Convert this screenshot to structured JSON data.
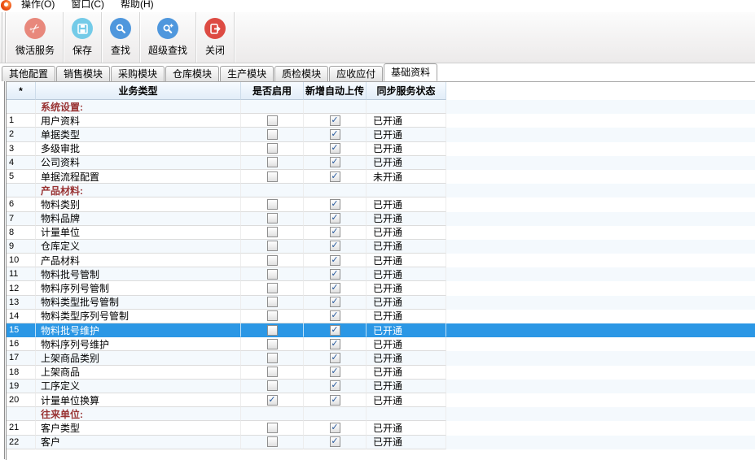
{
  "menu": {
    "logo_icon": "app-logo-icon",
    "items": [
      {
        "name": "operation",
        "label": "操作(O)"
      },
      {
        "name": "window",
        "label": "窗口(C)"
      },
      {
        "name": "help",
        "label": "帮助(H)"
      }
    ]
  },
  "toolbar": {
    "buttons": [
      {
        "name": "activate-service",
        "label": "微活服务",
        "icon": "scissors-icon",
        "circle_color": "#e8887c"
      },
      {
        "name": "save",
        "label": "保存",
        "icon": "floppy-disk-icon",
        "circle_color": "#74cbe8"
      },
      {
        "name": "find",
        "label": "查找",
        "icon": "magnifier-icon",
        "circle_color": "#4f97dd"
      },
      {
        "name": "super-find",
        "label": "超级查找",
        "icon": "magnifier-plus-icon",
        "circle_color": "#4f97dd"
      },
      {
        "name": "close",
        "label": "关闭",
        "icon": "exit-door-icon",
        "circle_color": "#dd4b43"
      }
    ]
  },
  "tabs": {
    "active": "基础资料",
    "items": [
      {
        "name": "other-config",
        "label": "其他配置"
      },
      {
        "name": "sales-module",
        "label": "销售模块"
      },
      {
        "name": "purchase-module",
        "label": "采购模块"
      },
      {
        "name": "warehouse-module",
        "label": "仓库模块"
      },
      {
        "name": "production-module",
        "label": "生产模块"
      },
      {
        "name": "qc-module",
        "label": "质检模块"
      },
      {
        "name": "ar-ap",
        "label": "应收应付"
      },
      {
        "name": "base-data",
        "label": "基础资料"
      }
    ]
  },
  "table": {
    "columns": [
      "*",
      "业务类型",
      "是否启用",
      "新增自动上传",
      "同步服务状态"
    ],
    "status_open": "已开通",
    "status_closed": "未开通",
    "selected_row": "15",
    "colors": {
      "selection_bg": "#2b97e5",
      "category_text": "#993333",
      "checkbox_check": "#25589c"
    },
    "rows": [
      {
        "category": "系统设置:"
      },
      {
        "num": "1",
        "name": "用户资料",
        "enabled": false,
        "auto_upload": true,
        "status": "已开通"
      },
      {
        "num": "2",
        "name": "单据类型",
        "enabled": false,
        "auto_upload": true,
        "status": "已开通"
      },
      {
        "num": "3",
        "name": "多级审批",
        "enabled": false,
        "auto_upload": true,
        "status": "已开通"
      },
      {
        "num": "4",
        "name": "公司资料",
        "enabled": false,
        "auto_upload": true,
        "status": "已开通"
      },
      {
        "num": "5",
        "name": "单据流程配置",
        "enabled": false,
        "auto_upload": true,
        "status": "未开通"
      },
      {
        "category": "产品材料:"
      },
      {
        "num": "6",
        "name": "物料类别",
        "enabled": false,
        "auto_upload": true,
        "status": "已开通"
      },
      {
        "num": "7",
        "name": "物料品牌",
        "enabled": false,
        "auto_upload": true,
        "status": "已开通"
      },
      {
        "num": "8",
        "name": "计量单位",
        "enabled": false,
        "auto_upload": true,
        "status": "已开通"
      },
      {
        "num": "9",
        "name": "仓库定义",
        "enabled": false,
        "auto_upload": true,
        "status": "已开通"
      },
      {
        "num": "10",
        "name": "产品材料",
        "enabled": false,
        "auto_upload": true,
        "status": "已开通"
      },
      {
        "num": "11",
        "name": "物料批号管制",
        "enabled": false,
        "auto_upload": true,
        "status": "已开通"
      },
      {
        "num": "12",
        "name": "物料序列号管制",
        "enabled": false,
        "auto_upload": true,
        "status": "已开通"
      },
      {
        "num": "13",
        "name": "物料类型批号管制",
        "enabled": false,
        "auto_upload": true,
        "status": "已开通"
      },
      {
        "num": "14",
        "name": "物料类型序列号管制",
        "enabled": false,
        "auto_upload": true,
        "status": "已开通"
      },
      {
        "num": "15",
        "name": "物料批号维护",
        "enabled": false,
        "auto_upload": true,
        "status": "已开通",
        "selected": true
      },
      {
        "num": "16",
        "name": "物料序列号维护",
        "enabled": false,
        "auto_upload": true,
        "status": "已开通"
      },
      {
        "num": "17",
        "name": "上架商品类别",
        "enabled": false,
        "auto_upload": true,
        "status": "已开通"
      },
      {
        "num": "18",
        "name": "上架商品",
        "enabled": false,
        "auto_upload": true,
        "status": "已开通"
      },
      {
        "num": "19",
        "name": "工序定义",
        "enabled": false,
        "auto_upload": true,
        "status": "已开通"
      },
      {
        "num": "20",
        "name": "计量单位换算",
        "enabled": true,
        "auto_upload": true,
        "status": "已开通"
      },
      {
        "category": "往来单位:"
      },
      {
        "num": "21",
        "name": "客户类型",
        "enabled": false,
        "auto_upload": true,
        "status": "已开通"
      },
      {
        "num": "22",
        "name": "客户",
        "enabled": false,
        "auto_upload": true,
        "status": "已开通"
      }
    ]
  }
}
